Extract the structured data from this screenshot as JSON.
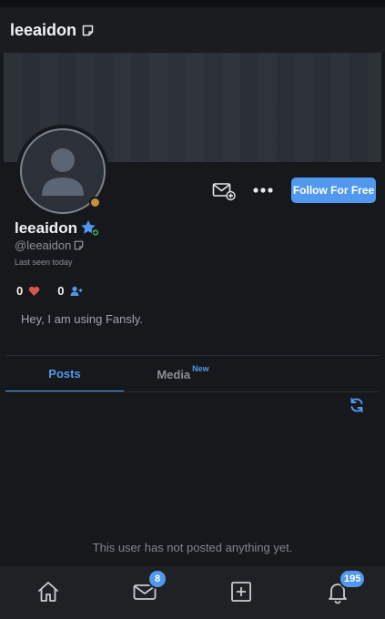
{
  "header": {
    "title": "leeaidon",
    "note_icon": "note-icon"
  },
  "profile": {
    "name": "leeaidon",
    "handle": "@leeaidon",
    "last_seen": "Last seen today",
    "likes_count": "0",
    "followers_count": "0",
    "bio": "Hey, I am using Fansly.",
    "verified_icon": "verified-star-icon",
    "status_color": "#c4913a"
  },
  "actions": {
    "follow_label": "Follow For Free",
    "message_icon": "mail-plus-icon",
    "more_icon": "more-dots-icon"
  },
  "tabs": [
    {
      "label": "Posts",
      "active": true
    },
    {
      "label": "Media",
      "badge": "New",
      "active": false
    }
  ],
  "feed": {
    "empty_text": "This user has not posted anything yet."
  },
  "bottom_nav": {
    "items": [
      {
        "icon": "home-icon"
      },
      {
        "icon": "mail-icon",
        "count": "8"
      },
      {
        "icon": "add-post-icon"
      },
      {
        "icon": "bell-icon",
        "count": "195"
      }
    ]
  },
  "colors": {
    "accent": "#5198ee",
    "background": "#16181c",
    "heart": "#d9534f"
  }
}
